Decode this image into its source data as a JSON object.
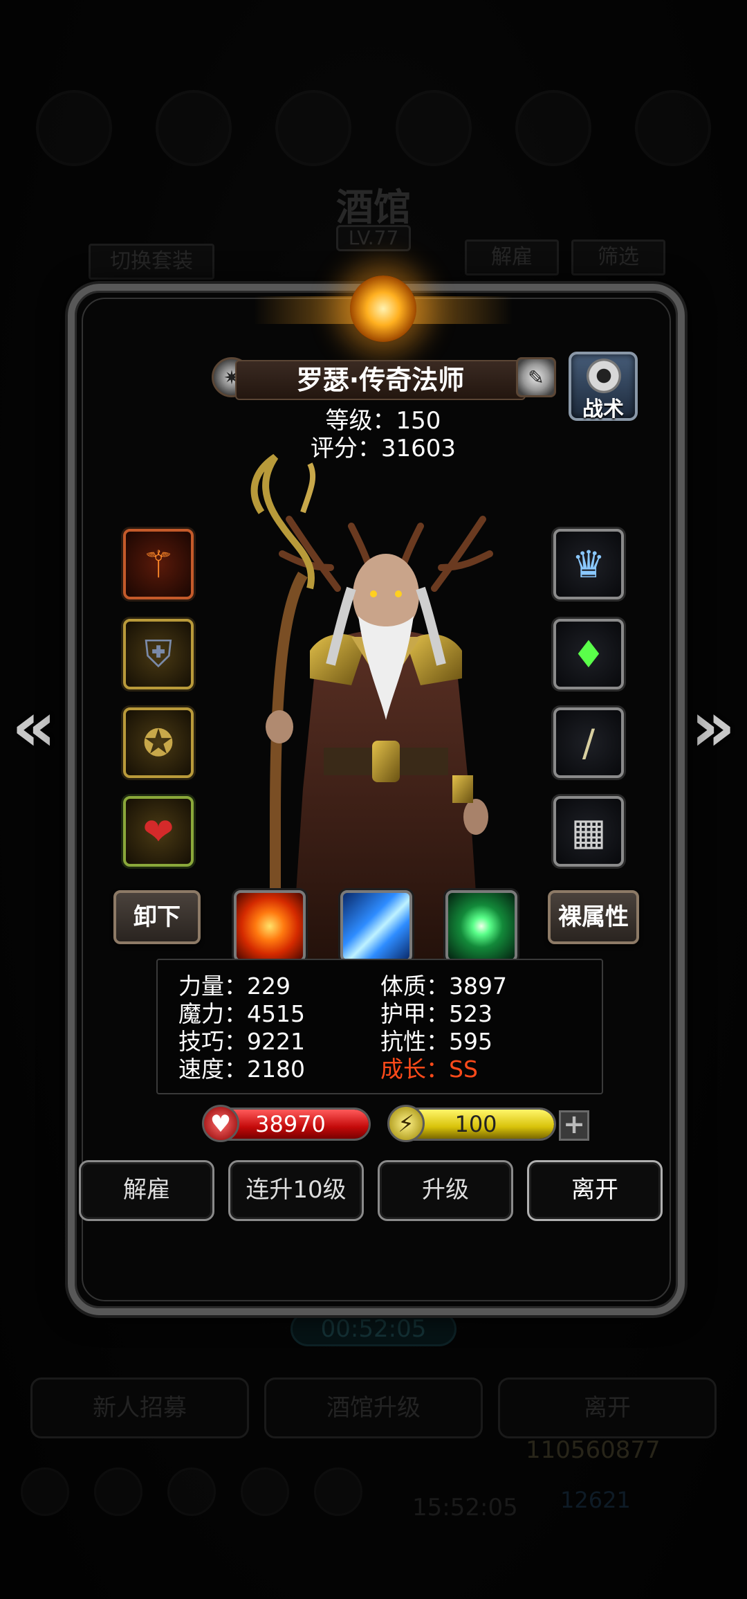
{
  "background": {
    "tavern_title": "酒馆",
    "tavern_level": "LV.77",
    "switch_set_label": "切换套装",
    "dismiss_label": "解雇",
    "filter_label": "筛选",
    "timer": "00:52:05",
    "recruit_label": "新人招募",
    "upgrade_tavern_label": "酒馆升级",
    "leave_label": "离开",
    "gold": "110560877",
    "gems": "12621",
    "clock": "15:52:05"
  },
  "hero": {
    "name": "罗瑟·传奇法师",
    "level_text": "等级：150",
    "score_text": "评分：31603",
    "tactics_label": "战术",
    "unequip_label": "卸下",
    "naked_attr_label": "裸属性"
  },
  "stats": {
    "strength": "力量：229",
    "magic": "魔力：4515",
    "skill": "技巧：9221",
    "speed": "速度：2180",
    "constitution": "体质：3897",
    "armor": "护甲：523",
    "resistance": "抗性：595",
    "growth": "成长：SS"
  },
  "bars": {
    "hp_value": "38970",
    "hp_fill": 1.0,
    "energy_value": "100",
    "energy_fill": 1.0,
    "plus_label": "+"
  },
  "actions": {
    "dismiss": "解雇",
    "level_up_10": "连升10级",
    "level_up": "升级",
    "leave": "离开"
  },
  "icons": {
    "left_arrow": "«",
    "right_arrow": "»",
    "hp_icon": "♥",
    "energy_icon": "⚡"
  },
  "colors": {
    "growth": "#ff4a1a",
    "hp": "#d41010",
    "energy": "#e0cc10"
  }
}
